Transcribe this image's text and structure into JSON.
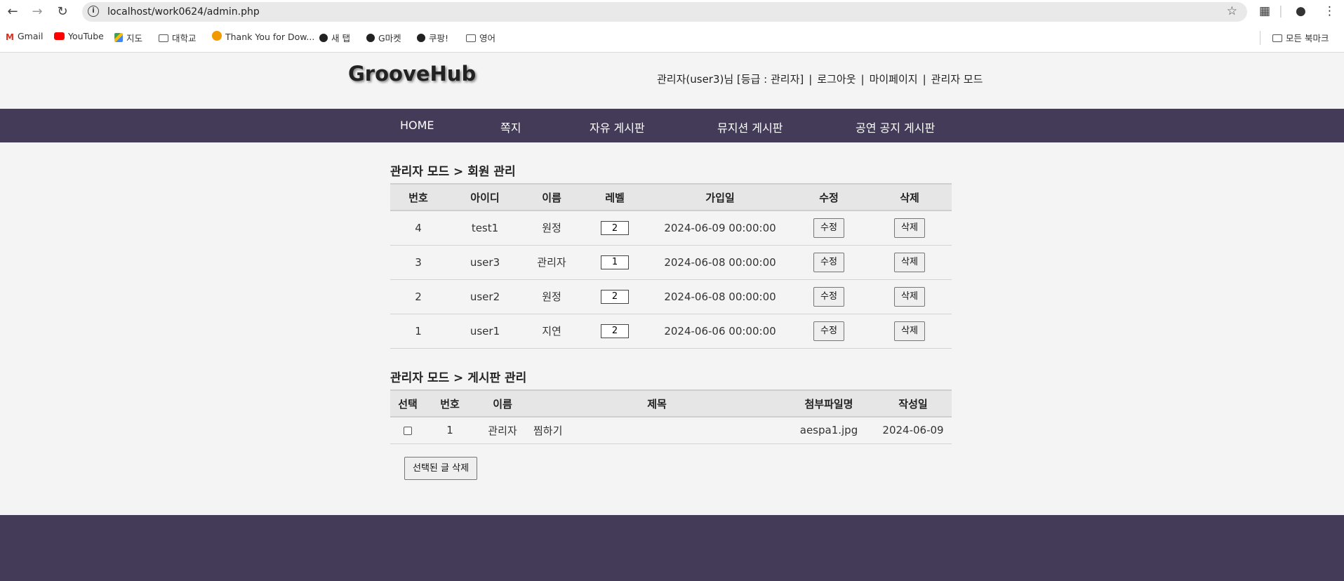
{
  "browser": {
    "url": "localhost/work0624/admin.php",
    "bookmarks": [
      {
        "label": "Gmail",
        "icon": "gmail-icon"
      },
      {
        "label": "YouTube",
        "icon": "youtube-icon"
      },
      {
        "label": "지도",
        "icon": "maps-icon"
      },
      {
        "label": "대학교",
        "icon": "folder-icon"
      },
      {
        "label": "Thank You for Dow...",
        "icon": "ef-icon"
      },
      {
        "label": "새 탭",
        "icon": "globe-icon"
      },
      {
        "label": "G마켓",
        "icon": "globe-icon"
      },
      {
        "label": "쿠팡!",
        "icon": "globe-icon"
      },
      {
        "label": "영어",
        "icon": "folder-icon"
      }
    ],
    "all_bookmarks": "모든 북마크"
  },
  "header": {
    "logo": "GrooveHub",
    "user_info": "관리자(user3)님 [등급 : 관리자]",
    "logout": "로그아웃",
    "mypage": "마이페이지",
    "admin_mode": "관리자 모드",
    "separator": "|"
  },
  "nav": {
    "items": [
      "HOME",
      "쪽지",
      "자유 게시판",
      "뮤지션 게시판",
      "공연 공지 게시판"
    ]
  },
  "members": {
    "title": "관리자 모드 > 회원 관리",
    "columns": [
      "번호",
      "아이디",
      "이름",
      "레벨",
      "가입일",
      "수정",
      "삭제"
    ],
    "edit_label": "수정",
    "delete_label": "삭제",
    "rows": [
      {
        "no": "4",
        "id": "test1",
        "name": "원정",
        "level": "2",
        "joined": "2024-06-09 00:00:00"
      },
      {
        "no": "3",
        "id": "user3",
        "name": "관리자",
        "level": "1",
        "joined": "2024-06-08 00:00:00"
      },
      {
        "no": "2",
        "id": "user2",
        "name": "원정",
        "level": "2",
        "joined": "2024-06-08 00:00:00"
      },
      {
        "no": "1",
        "id": "user1",
        "name": "지연",
        "level": "2",
        "joined": "2024-06-06 00:00:00"
      }
    ]
  },
  "board": {
    "title": "관리자 모드 > 게시판 관리",
    "columns": [
      "선택",
      "번호",
      "이름",
      "제목",
      "첨부파일명",
      "작성일"
    ],
    "rows": [
      {
        "no": "1",
        "name": "관리자",
        "subject": "찜하기",
        "file": "aespa1.jpg",
        "date": "2024-06-09"
      }
    ],
    "delete_selected": "선택된 글 삭제"
  }
}
